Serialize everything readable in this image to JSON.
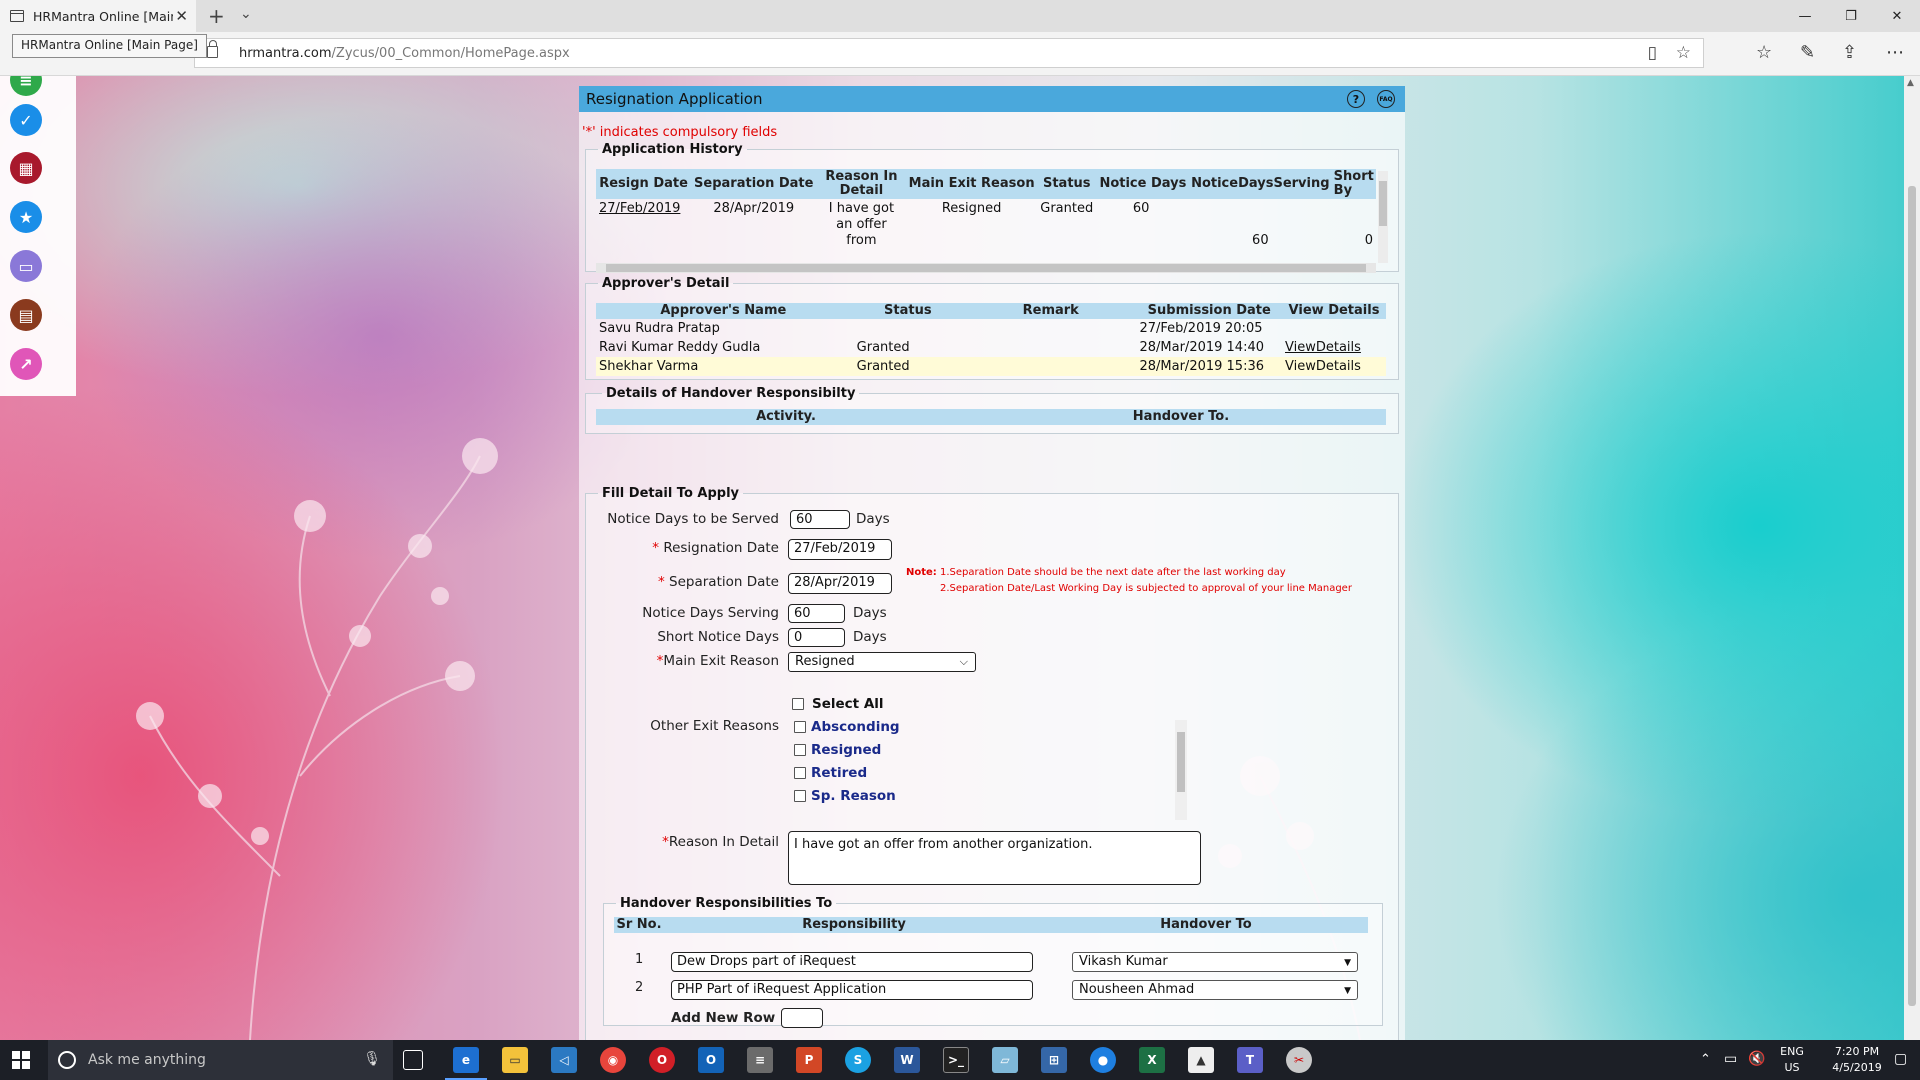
{
  "browser": {
    "tab_title": "HRMantra Online [Main",
    "tab_tooltip": "HRMantra Online [Main Page]",
    "url_host": "hrmantra.com",
    "url_path": "/Zycus/00_Common/HomePage.aspx"
  },
  "panel": {
    "title": "Resignation Application",
    "help_icon": "?",
    "faq_icon": "FAQ",
    "compulsory_note": "'*' indicates compulsory fields"
  },
  "history": {
    "legend": "Application History",
    "columns": [
      "Resign Date",
      "Separation Date",
      "Reason In Detail",
      "Main Exit Reason",
      "Status",
      "Notice Days",
      "NoticeDaysServing",
      "Short By"
    ],
    "row": {
      "resign_date": "27/Feb/2019",
      "separation_date": "28/Apr/2019",
      "reason": "I have got an offer from",
      "main_exit_reason": "Resigned",
      "status": "Granted",
      "notice_days": "60",
      "notice_days_serving": "60",
      "short_by": "0"
    }
  },
  "approvers": {
    "legend": "Approver's Detail",
    "columns": [
      "Approver's Name",
      "Status",
      "Remark",
      "Submission Date",
      "View Details"
    ],
    "rows": [
      {
        "name": "Savu Rudra Pratap",
        "status": "",
        "remark": "",
        "date": "27/Feb/2019 20:05",
        "view": ""
      },
      {
        "name": "Ravi Kumar Reddy Gudla",
        "status": "Granted",
        "remark": "",
        "date": "28/Mar/2019 14:40",
        "view": "ViewDetails"
      },
      {
        "name": "Shekhar Varma",
        "status": "Granted",
        "remark": "",
        "date": "28/Mar/2019 15:36",
        "view": "ViewDetails"
      }
    ]
  },
  "handover_detail": {
    "legend": "Details of Handover Responsibilty",
    "columns": [
      "Activity.",
      "Handover To."
    ]
  },
  "form": {
    "legend": "Fill Detail To Apply",
    "notice_days_label": "Notice Days to be Served",
    "notice_days_value": "60",
    "days_unit": "Days",
    "resignation_date_label": "Resignation Date",
    "resignation_date_value": "27/Feb/2019",
    "separation_date_label": "Separation Date",
    "separation_date_value": "28/Apr/2019",
    "note_title": "Note:",
    "note_line1": "1.Separation Date should be the next date after the last working day",
    "note_line2": "2.Separation Date/Last Working Day is subjected to approval of your line Manager",
    "notice_serving_label": "Notice Days Serving",
    "notice_serving_value": "60",
    "short_notice_label": "Short Notice Days",
    "short_notice_value": "0",
    "main_exit_label": "Main Exit Reason",
    "main_exit_value": "Resigned",
    "other_exit_label": "Other Exit Reasons",
    "select_all_label": "Select All",
    "other_reasons": [
      "Absconding",
      "Resigned",
      "Retired",
      "Sp. Reason"
    ],
    "reason_detail_label": "Reason In Detail",
    "reason_detail_value": "I have got an offer from another organization."
  },
  "handover_to": {
    "legend": "Handover Responsibilities To",
    "columns": [
      "Sr No.",
      "Responsibility",
      "Handover To"
    ],
    "rows": [
      {
        "sr": "1",
        "responsibility": "Dew Drops part of iRequest",
        "handover": "Vikash Kumar"
      },
      {
        "sr": "2",
        "responsibility": "PHP Part of iRequest Application",
        "handover": "Nousheen Ahmad"
      }
    ],
    "add_row_label": "Add New Row"
  },
  "taskbar": {
    "search_placeholder": "Ask me anything",
    "language": "ENG",
    "region": "US",
    "time": "7:20 PM",
    "date": "4/5/2019"
  },
  "colors": {
    "header_blue": "#4aa8dc",
    "table_header": "#b8dcf0",
    "highlight_row": "#fffbd7",
    "required_red": "#e00000",
    "checkbox_label_blue": "#1a2a8a"
  }
}
